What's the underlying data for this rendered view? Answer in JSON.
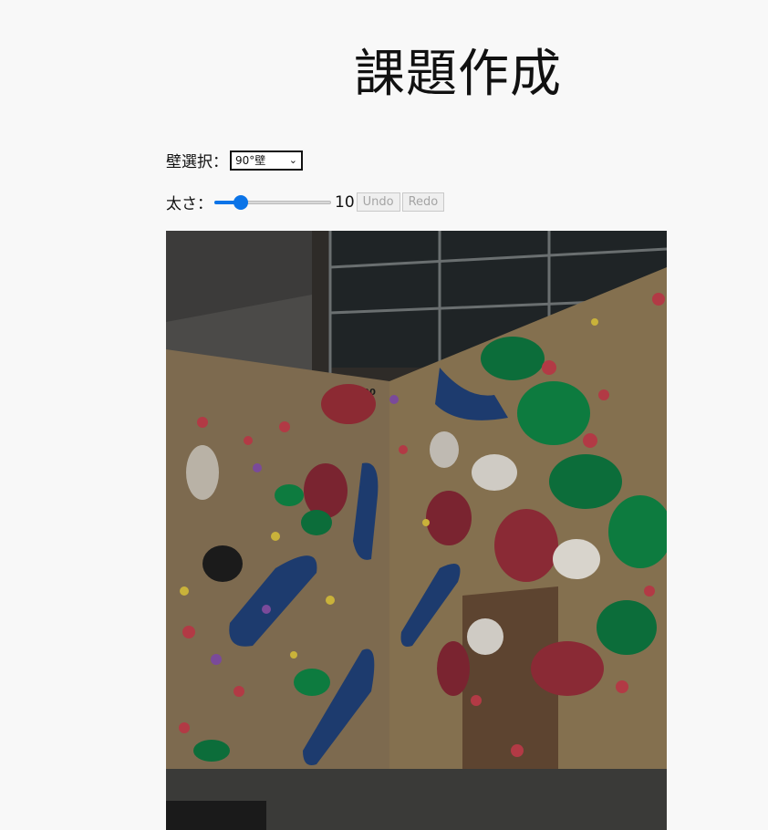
{
  "page": {
    "title": "課題作成"
  },
  "wall_select": {
    "label": "壁選択：",
    "selected": "90°壁"
  },
  "brush": {
    "label": "太さ：",
    "value": "10",
    "min": 1,
    "max": 50,
    "current": 10
  },
  "actions": {
    "undo": "Undo",
    "redo": "Redo"
  },
  "wall_image": {
    "panel_number": "90"
  }
}
